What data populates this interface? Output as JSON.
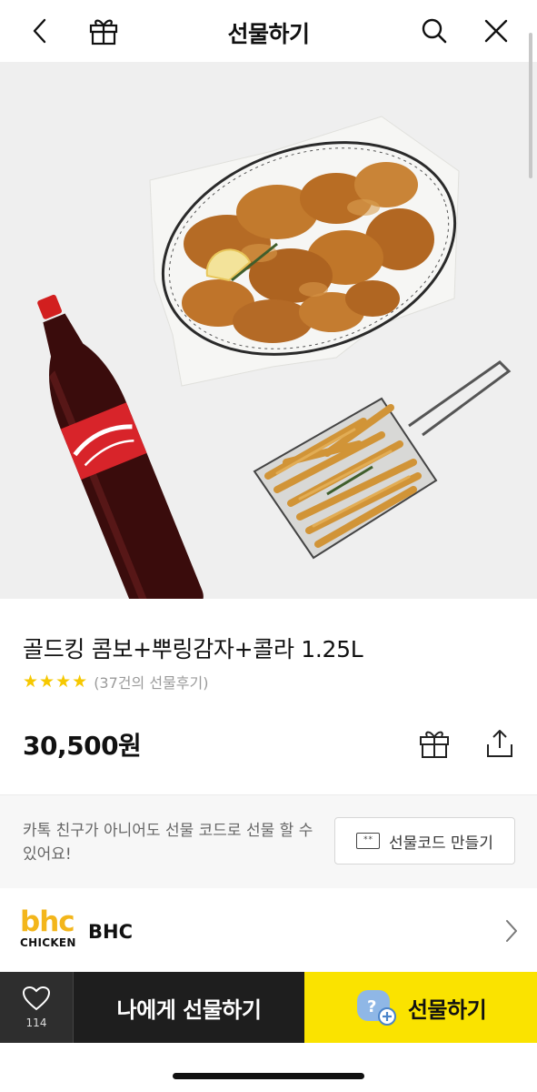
{
  "header": {
    "title": "선물하기",
    "back_icon": "chevron-left-icon",
    "gift_icon": "gift-box-icon",
    "search_icon": "search-icon",
    "close_icon": "close-icon"
  },
  "product": {
    "name": "골드킹 콤보+뿌링감자+콜라 1.25L",
    "rating_stars": 4,
    "review_text": "(37건의 선물후기)",
    "price": "30,500원"
  },
  "gift_code": {
    "description": "카톡 친구가 아니어도 선물 코드로 선물 할 수 있어요!",
    "button_label": "선물코드 만들기",
    "button_icon_text": "**"
  },
  "brand": {
    "logo_top": "bhc",
    "logo_bottom": "CHICKEN",
    "name": "BHC"
  },
  "bottom_bar": {
    "like_count": "114",
    "self_gift_label": "나에게 선물하기",
    "gift_label": "선물하기"
  },
  "colors": {
    "accent_yellow": "#fae300",
    "star_yellow": "#f6c800",
    "dark_button": "#1e1e1e",
    "brand_gold": "#f3b61b"
  }
}
